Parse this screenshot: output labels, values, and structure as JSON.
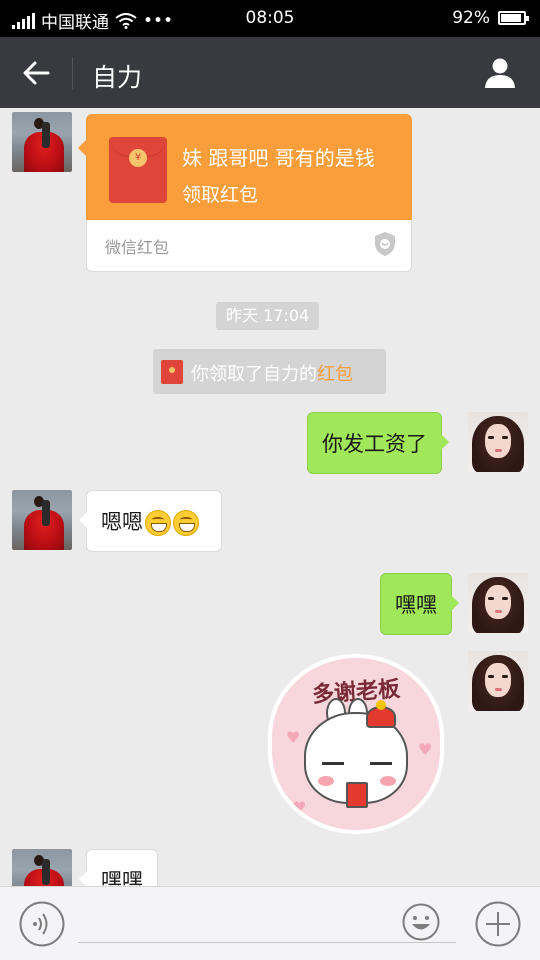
{
  "status_bar": {
    "carrier": "中国联通",
    "time": "08:05",
    "battery": "92%",
    "battery_level": 0.92,
    "more": "•••"
  },
  "header": {
    "title": "自力",
    "icons": {
      "back": "back-arrow-icon",
      "profile": "person-icon"
    }
  },
  "chat": {
    "red_packet": {
      "message": "妹  跟哥吧  哥有的是钱",
      "action": "领取红包",
      "footer": "微信红包"
    },
    "timestamp": "昨天 17:04",
    "system_notice": {
      "prefix": "你领取了自力的",
      "highlight": "红包"
    },
    "messages": [
      {
        "side": "right",
        "text": "你发工资了"
      },
      {
        "side": "left",
        "text": "嗯嗯",
        "emoji_count": 2,
        "emoji": "grin-icon"
      },
      {
        "side": "right",
        "text": "嘿嘿"
      },
      {
        "side": "right",
        "sticker": "多谢老板"
      },
      {
        "side": "left",
        "text": "嘿嘿"
      }
    ]
  },
  "input_bar": {
    "text": "",
    "icons": {
      "voice": "voice-icon",
      "emoji": "emoji-icon",
      "more": "plus-icon"
    }
  },
  "colors": {
    "header_bg": "#393a3f",
    "chat_bg": "#ebebeb",
    "red_packet": "#fa9d3b",
    "sent_bubble": "#a0e75a",
    "received_bubble": "#ffffff"
  }
}
